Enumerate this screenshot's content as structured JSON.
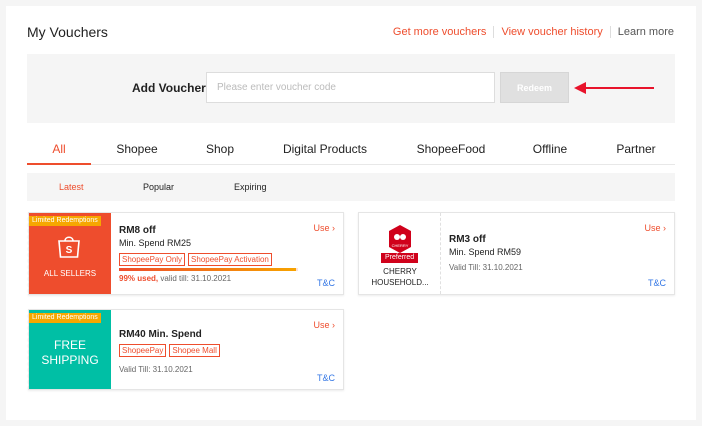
{
  "header": {
    "title": "My Vouchers",
    "links": [
      "Get more vouchers",
      "View voucher history",
      "Learn more"
    ]
  },
  "add_voucher": {
    "label": "Add Voucher",
    "placeholder": "Please enter voucher code",
    "button": "Redeem"
  },
  "tabs": [
    "All",
    "Shopee",
    "Shop",
    "Digital Products",
    "ShopeeFood",
    "Offline",
    "Partner"
  ],
  "subtabs": [
    "Latest",
    "Popular",
    "Expiring"
  ],
  "vouchers": [
    {
      "badge": "Limited Redemptions",
      "side_label": "ALL SELLERS",
      "title": "RM8 off",
      "subtitle": "Min. Spend RM25",
      "tags": [
        "ShopeePay Only",
        "ShopeePay Activation"
      ],
      "used_pct": "99% used,",
      "used_fraction": 0.99,
      "valid": "valid till: 31.10.2021",
      "use": "Use",
      "tnc": "T&C"
    },
    {
      "badge": "Limited Redemptions",
      "side_label_1": "FREE",
      "side_label_2": "SHIPPING",
      "title": "RM40 Min. Spend",
      "tags": [
        "ShopeePay",
        "Shopee Mall"
      ],
      "valid": "Valid Till: 31.10.2021",
      "use": "Use",
      "tnc": "T&C"
    },
    {
      "preferred": "Preferred",
      "shop_line_1": "CHERRY",
      "shop_line_2": "HOUSEHOLD...",
      "logo_text": "CHERRY",
      "title": "RM3 off",
      "subtitle": "Min. Spend RM59",
      "valid": "Valid Till: 31.10.2021",
      "use": "Use",
      "tnc": "T&C"
    }
  ],
  "colors": {
    "accent": "#ee4d2d",
    "teal": "#00bfa5",
    "badge": "#f6a700",
    "link": "#3477e5",
    "arrow": "#e8132b"
  }
}
